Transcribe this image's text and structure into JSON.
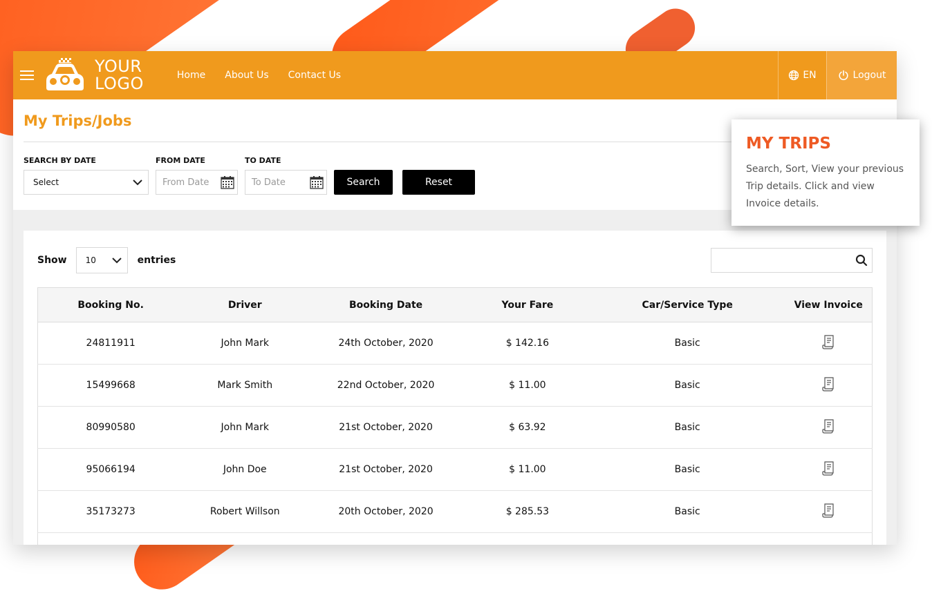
{
  "header": {
    "logo_line1": "YOUR",
    "logo_line2": "LOGO",
    "nav": [
      "Home",
      "About Us",
      "Contact Us"
    ],
    "language": "EN",
    "logout": "Logout"
  },
  "filters": {
    "title": "My Trips/Jobs",
    "search_by_date_label": "SEARCH BY DATE",
    "search_by_date_value": "Select",
    "from_date_label": "FROM DATE",
    "from_date_placeholder": "From Date",
    "to_date_label": "TO DATE",
    "to_date_placeholder": "To Date",
    "search_button": "Search",
    "reset_button": "Reset"
  },
  "table": {
    "show_label": "Show",
    "entries_value": "10",
    "entries_label": "entries",
    "columns": [
      "Booking No.",
      "Driver",
      "Booking Date",
      "Your Fare",
      "Car/Service Type",
      "View Invoice"
    ],
    "rows": [
      {
        "booking_no": "24811911",
        "driver": "John Mark",
        "date": "24th October, 2020",
        "fare": "$ 142.16",
        "type": "Basic"
      },
      {
        "booking_no": "15499668",
        "driver": "Mark Smith",
        "date": "22nd October, 2020",
        "fare": "$ 11.00",
        "type": "Basic"
      },
      {
        "booking_no": "80990580",
        "driver": "John Mark",
        "date": "21st October, 2020",
        "fare": "$ 63.92",
        "type": "Basic"
      },
      {
        "booking_no": "95066194",
        "driver": "John Doe",
        "date": "21st October, 2020",
        "fare": "$ 11.00",
        "type": "Basic"
      },
      {
        "booking_no": "35173273",
        "driver": "Robert Willson",
        "date": "20th October, 2020",
        "fare": "$ 285.53",
        "type": "Basic"
      }
    ]
  },
  "tooltip": {
    "title": "MY TRIPS",
    "text": "Search, Sort, View your previous Trip details. Click and view Invoice details."
  },
  "colors": {
    "brand_orange": "#f09a1d",
    "tooltip_accent": "#ee5a24",
    "stripe": "#ff5a1a"
  },
  "icons": [
    "menu-icon",
    "taxi-car-icon",
    "globe-icon",
    "power-icon",
    "chevron-down-icon",
    "calendar-icon",
    "search-icon",
    "invoice-icon"
  ]
}
